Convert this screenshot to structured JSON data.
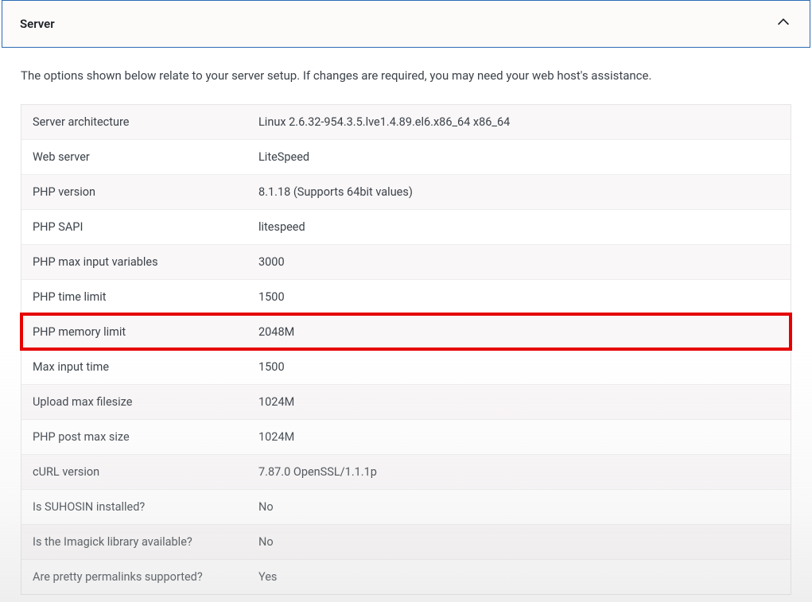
{
  "panel": {
    "title": "Server",
    "description": "The options shown below relate to your server setup. If changes are required, you may need your web host's assistance."
  },
  "rows": [
    {
      "label": "Server architecture",
      "value": "Linux 2.6.32-954.3.5.lve1.4.89.el6.x86_64 x86_64",
      "highlight": false
    },
    {
      "label": "Web server",
      "value": "LiteSpeed",
      "highlight": false
    },
    {
      "label": "PHP version",
      "value": "8.1.18 (Supports 64bit values)",
      "highlight": false
    },
    {
      "label": "PHP SAPI",
      "value": "litespeed",
      "highlight": false
    },
    {
      "label": "PHP max input variables",
      "value": "3000",
      "highlight": false
    },
    {
      "label": "PHP time limit",
      "value": "1500",
      "highlight": false
    },
    {
      "label": "PHP memory limit",
      "value": "2048M",
      "highlight": true
    },
    {
      "label": "Max input time",
      "value": "1500",
      "highlight": false
    },
    {
      "label": "Upload max filesize",
      "value": "1024M",
      "highlight": false
    },
    {
      "label": "PHP post max size",
      "value": "1024M",
      "highlight": false
    },
    {
      "label": "cURL version",
      "value": "7.87.0 OpenSSL/1.1.1p",
      "highlight": false
    },
    {
      "label": "Is SUHOSIN installed?",
      "value": "No",
      "highlight": false
    },
    {
      "label": "Is the Imagick library available?",
      "value": "No",
      "highlight": false
    },
    {
      "label": "Are pretty permalinks supported?",
      "value": "Yes",
      "highlight": false
    }
  ]
}
